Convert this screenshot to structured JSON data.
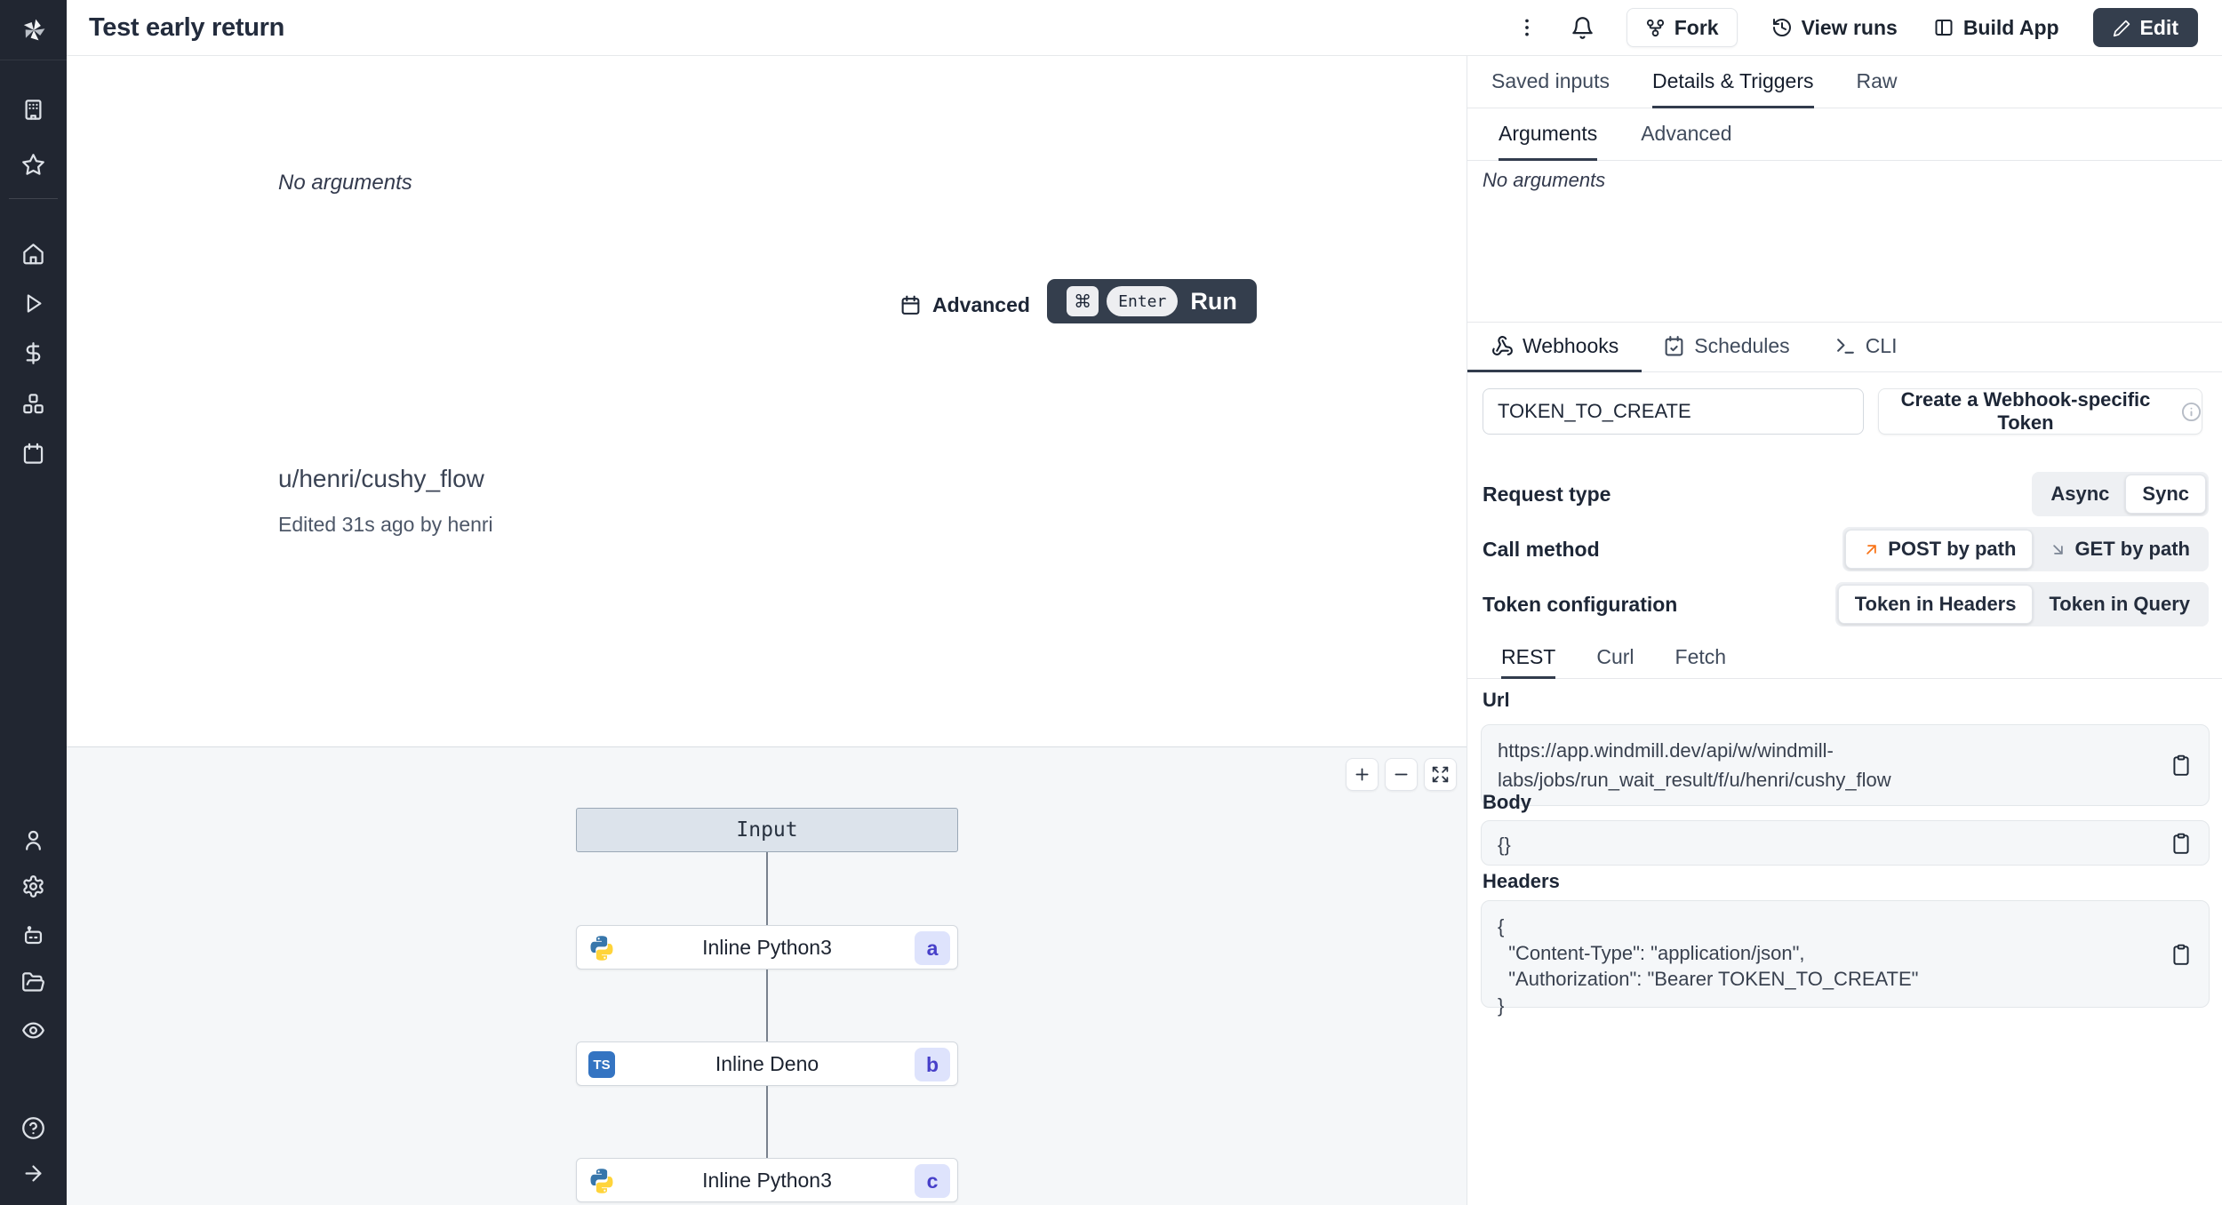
{
  "colors": {
    "sidebar_bg": "#212631",
    "dark_button_bg": "#343e4d",
    "badge_bg": "#dee3fc",
    "badge_text": "#4740c9",
    "accent_orange": "#f97316",
    "python_blue": "#3776ab",
    "python_yellow": "#ffd43b",
    "typescript_blue": "#3474c2",
    "active_tab_underline": "#323c4d"
  },
  "sidebar": {
    "icons": [
      "windmill-logo",
      "building",
      "star",
      "home",
      "play",
      "dollar",
      "boxes",
      "calendar",
      "user",
      "gear",
      "robot",
      "folder-open",
      "eye",
      "help-circle",
      "arrow-right"
    ]
  },
  "topbar": {
    "title": "Test early return",
    "fork": "Fork",
    "view_runs": "View runs",
    "build_app": "Build App",
    "edit": "Edit"
  },
  "run_panel": {
    "no_arguments": "No arguments",
    "advanced": "Advanced",
    "run_button": {
      "meta_key": "⌘",
      "enter_key": "Enter",
      "label": "Run"
    },
    "flow_path": "u/henri/cushy_flow",
    "edited": "Edited 31s ago by henri"
  },
  "graph": {
    "input_label": "Input",
    "ts_icon_text": "TS",
    "nodes": [
      {
        "label": "Inline Python3",
        "badge": "a",
        "language": "python"
      },
      {
        "label": "Inline Deno",
        "badge": "b",
        "language": "typescript"
      },
      {
        "label": "Inline Python3",
        "badge": "c",
        "language": "python"
      }
    ]
  },
  "details_panel": {
    "tabs": [
      "Saved inputs",
      "Details & Triggers",
      "Raw"
    ],
    "active_tab": "Details & Triggers",
    "subtabs": [
      "Arguments",
      "Advanced"
    ],
    "active_subtab": "Arguments",
    "no_arguments": "No arguments",
    "triggers": {
      "tabs": [
        "Webhooks",
        "Schedules",
        "CLI"
      ],
      "active_tab": "Webhooks",
      "token_input_value": "TOKEN_TO_CREATE",
      "create_token_button": "Create a Webhook-specific Token",
      "rows": [
        {
          "label": "Request type",
          "options": [
            "Async",
            "Sync"
          ],
          "selected": "Sync"
        },
        {
          "label": "Call method",
          "options": [
            "POST by path",
            "GET by path"
          ],
          "selected": "POST by path"
        },
        {
          "label": "Token configuration",
          "options": [
            "Token in Headers",
            "Token in Query"
          ],
          "selected": "Token in Headers"
        }
      ],
      "snippet_tabs": [
        "REST",
        "Curl",
        "Fetch"
      ],
      "active_snippet_tab": "REST",
      "url_label": "Url",
      "url_value": "https://app.windmill.dev/api/w/windmill-labs/jobs/run_wait_result/f/u/henri/cushy_flow",
      "body_label": "Body",
      "body_value": "{}",
      "headers_label": "Headers",
      "headers_value": "{\n  \"Content-Type\": \"application/json\",\n  \"Authorization\": \"Bearer TOKEN_TO_CREATE\"\n}"
    }
  }
}
